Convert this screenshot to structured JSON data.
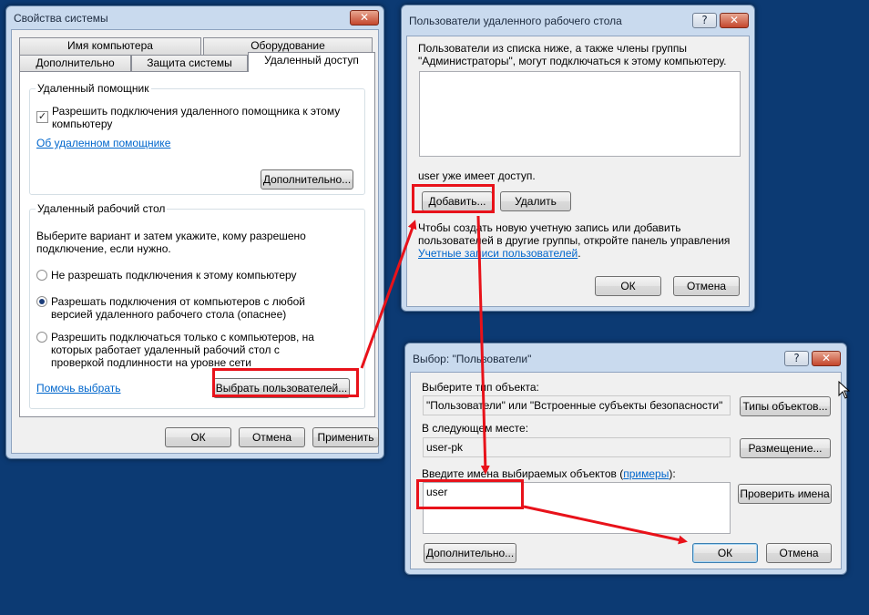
{
  "sys_props": {
    "title": "Свойства системы",
    "close_glyph": "✕",
    "tabs_row1": [
      "Имя компьютера",
      "Оборудование"
    ],
    "tabs_row2": [
      "Дополнительно",
      "Защита системы",
      "Удаленный доступ"
    ],
    "assist": {
      "group_title": "Удаленный помощник",
      "checkbox_label": "Разрешить подключения удаленного помощника к этому компьютеру",
      "checked_glyph": "✓",
      "link": "Об удаленном помощнике",
      "advanced_button": "Дополнительно..."
    },
    "rdp": {
      "group_title": "Удаленный рабочий стол",
      "intro": "Выберите вариант и затем укажите, кому разрешено подключение, если нужно.",
      "options": [
        "Не разрешать подключения к этому компьютеру",
        "Разрешать подключения от компьютеров с любой версией удаленного рабочего стола (опаснее)",
        "Разрешить подключаться только с компьютеров, на которых работает удаленный рабочий стол с проверкой подлинности на уровне сети"
      ],
      "help_link": "Помочь выбрать",
      "select_users_button": "Выбрать пользователей..."
    },
    "buttons": {
      "ok": "ОК",
      "cancel": "Отмена",
      "apply": "Применить"
    }
  },
  "rdp_users": {
    "title": "Пользователи удаленного рабочего стола",
    "help_glyph": "?",
    "close_glyph": "✕",
    "description": "Пользователи из списка ниже, а также члены группы \"Администраторы\", могут подключаться к этому компьютеру.",
    "access_note": "user уже имеет доступ.",
    "add_button": "Добавить...",
    "remove_button": "Удалить",
    "info_text": "Чтобы создать новую учетную запись или добавить пользователей в другие группы, откройте панель управления",
    "info_link": "Учетные записи пользователей",
    "info_end": ".",
    "ok": "ОК",
    "cancel": "Отмена"
  },
  "select_users": {
    "title": "Выбор: \"Пользователи\"",
    "help_glyph": "?",
    "close_glyph": "✕",
    "object_type_label": "Выберите тип объекта:",
    "object_type_value": "\"Пользователи\" или \"Встроенные субъекты безопасности\"",
    "object_types_button": "Типы объектов...",
    "location_label": "В следующем месте:",
    "location_value": "user-pk",
    "locations_button": "Размещение...",
    "names_label": "Введите имена выбираемых объектов (",
    "names_label_link": "примеры",
    "names_label_end": "):",
    "names_value": "user",
    "check_names_button": "Проверить имена",
    "advanced_button": "Дополнительно...",
    "ok": "ОК",
    "cancel": "Отмена"
  },
  "colors": {
    "desktop": "#0c3a73",
    "annotation": "#e8121a",
    "link": "#0066cc"
  }
}
